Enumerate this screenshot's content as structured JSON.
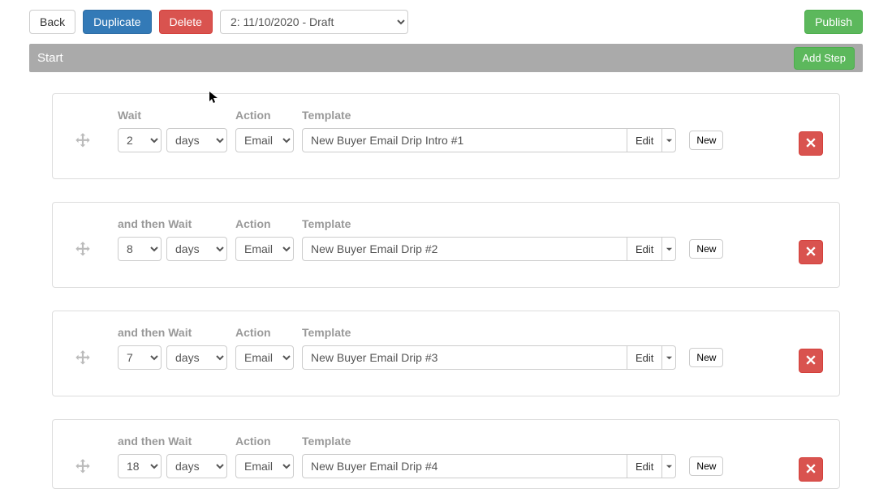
{
  "toolbar": {
    "back": "Back",
    "duplicate": "Duplicate",
    "delete": "Delete",
    "draft_selected": "2: 11/10/2020 - Draft",
    "publish": "Publish"
  },
  "start_bar": {
    "label": "Start",
    "add_step": "Add Step"
  },
  "common": {
    "action_label": "Action",
    "template_label": "Template",
    "edit": "Edit",
    "new": "New"
  },
  "steps": [
    {
      "wait_label": "Wait",
      "wait_num": "2",
      "wait_unit": "days",
      "action": "Email",
      "template": "New Buyer Email Drip Intro #1"
    },
    {
      "wait_label": "and then Wait",
      "wait_num": "8",
      "wait_unit": "days",
      "action": "Email",
      "template": "New Buyer Email Drip #2"
    },
    {
      "wait_label": "and then Wait",
      "wait_num": "7",
      "wait_unit": "days",
      "action": "Email",
      "template": "New Buyer Email Drip #3"
    },
    {
      "wait_label": "and then Wait",
      "wait_num": "18",
      "wait_unit": "days",
      "action": "Email",
      "template": "New Buyer Email Drip #4"
    }
  ]
}
